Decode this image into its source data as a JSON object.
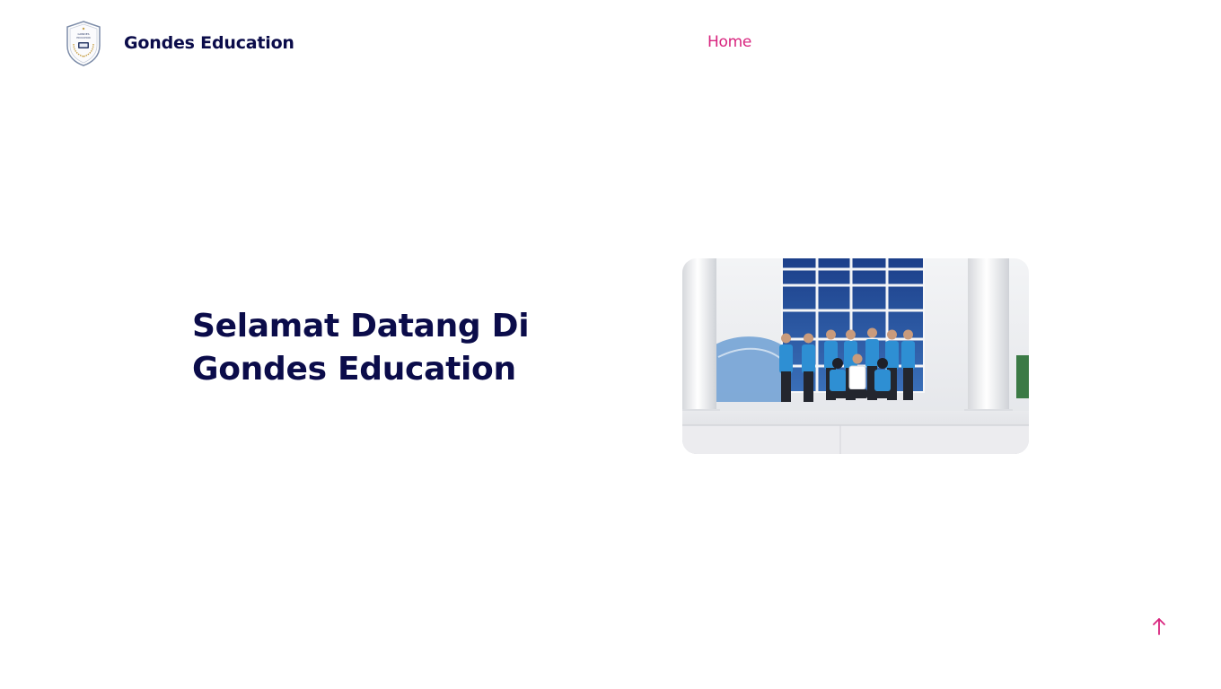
{
  "header": {
    "brand_name": "Gondes Education",
    "logo_text": "GONDES EDUCATION",
    "logo_icon": "school-crest-icon",
    "nav": [
      {
        "label": "Home",
        "active": true
      }
    ]
  },
  "hero": {
    "title_line1": "Selamat Datang Di",
    "title_line2": "Gondes Education",
    "photo_description_icon": "group-photo-image"
  },
  "back_to_top": {
    "icon": "arrow-up-icon"
  },
  "colors": {
    "primary_text": "#0b0c4a",
    "accent": "#d8247e",
    "background": "#ffffff"
  }
}
